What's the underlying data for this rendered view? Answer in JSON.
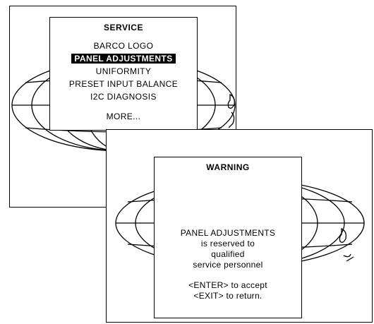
{
  "service_screen": {
    "title": "SERVICE",
    "items": [
      {
        "label": "BARCO LOGO",
        "selected": false
      },
      {
        "label": "PANEL ADJUSTMENTS",
        "selected": true
      },
      {
        "label": "UNIFORMITY",
        "selected": false
      },
      {
        "label": "PRESET INPUT BALANCE",
        "selected": false
      },
      {
        "label": "I2C DIAGNOSIS",
        "selected": false
      }
    ],
    "more_label": "MORE..."
  },
  "warning_screen": {
    "title": "WARNING",
    "message_lines": [
      "PANEL ADJUSTMENTS",
      "is reserved to",
      "qualified",
      "service personnel"
    ],
    "action_lines": [
      "<ENTER> to accept",
      "<EXIT> to return."
    ]
  }
}
